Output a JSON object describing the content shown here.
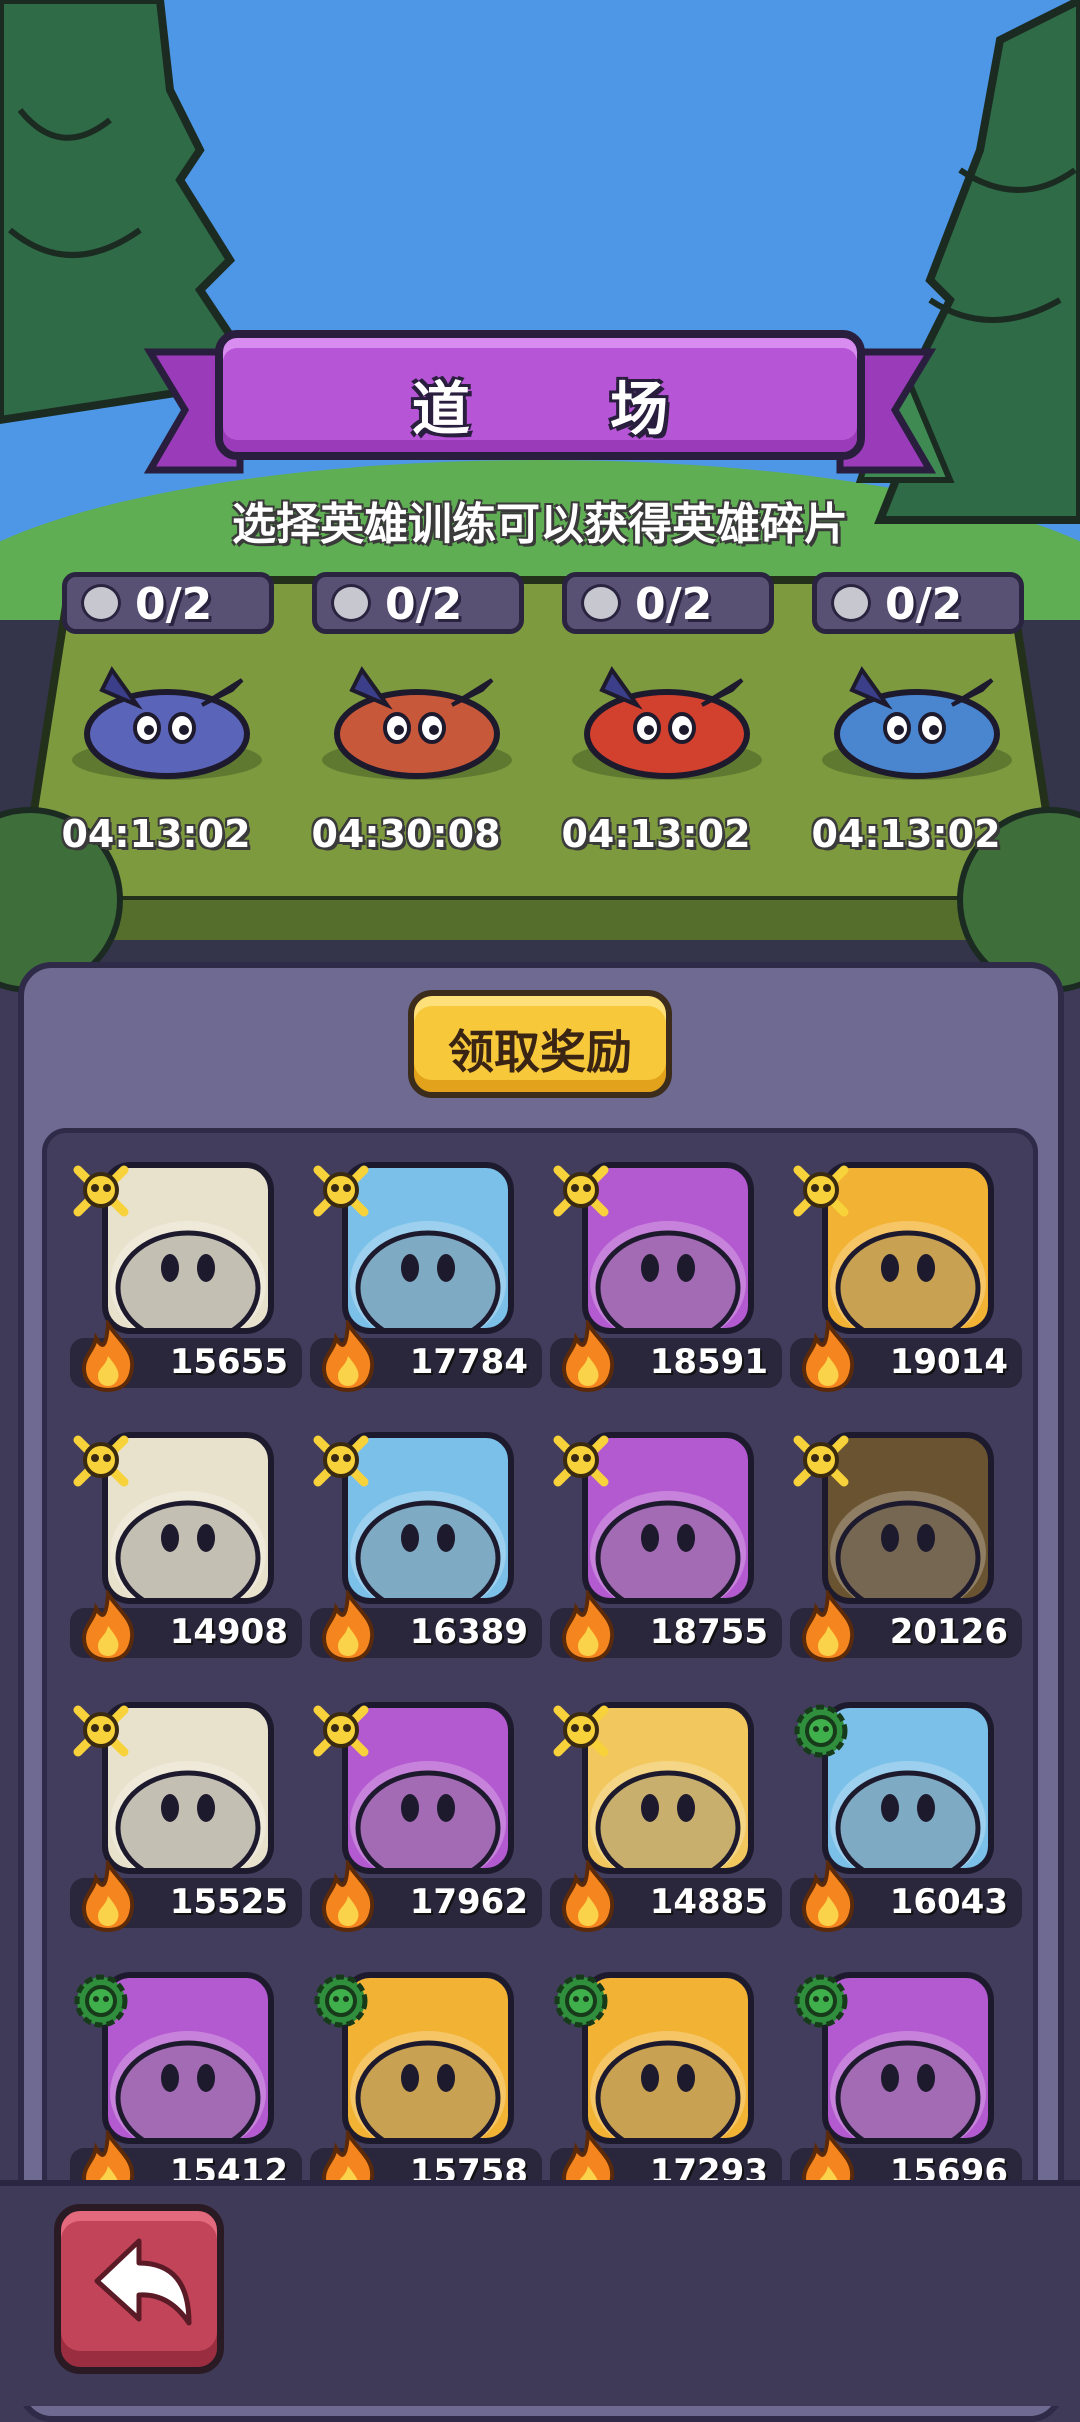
{
  "header": {
    "title": "道 场",
    "subtitle": "选择英雄训练可以获得英雄碎片"
  },
  "training_slots": [
    {
      "count": "0/2",
      "timer": "04:13:02",
      "hero_icon": "purple-horned-hero"
    },
    {
      "count": "0/2",
      "timer": "04:30:08",
      "hero_icon": "red-tentacle-shell-hero"
    },
    {
      "count": "0/2",
      "timer": "04:13:02",
      "hero_icon": "orange-bomb-hero"
    },
    {
      "count": "0/2",
      "timer": "04:13:02",
      "hero_icon": "blue-archer-hero"
    }
  ],
  "reward_button": {
    "label": "领取奖励"
  },
  "heroes": [
    {
      "power": "15655",
      "badge": "skull",
      "icon": "grey-helmet-hero",
      "bg": "#e8e2cc"
    },
    {
      "power": "17784",
      "badge": "skull",
      "icon": "red-horned-hero",
      "bg": "#7bc0e8"
    },
    {
      "power": "18591",
      "badge": "skull",
      "icon": "knight-helmet-hero",
      "bg": "#b45ad0"
    },
    {
      "power": "19014",
      "badge": "skull",
      "icon": "gold-crest-hero",
      "bg": "#f2b233"
    },
    {
      "power": "14908",
      "badge": "skull",
      "icon": "green-slime-hero",
      "bg": "#e8e2cc"
    },
    {
      "power": "16389",
      "badge": "skull",
      "icon": "cat-mask-hero",
      "bg": "#7bc0e8"
    },
    {
      "power": "18755",
      "badge": "skull",
      "icon": "green-hat-hero",
      "bg": "#b45ad0"
    },
    {
      "power": "20126",
      "badge": "skull",
      "icon": "brown-check-hero",
      "bg": "#6a5330"
    },
    {
      "power": "15525",
      "badge": "skull",
      "icon": "pink-bow-hero",
      "bg": "#e8e2cc"
    },
    {
      "power": "17962",
      "badge": "skull",
      "icon": "skull-hat-hero",
      "bg": "#b45ad0"
    },
    {
      "power": "14885",
      "badge": "skull",
      "icon": "pink-crown-hero",
      "bg": "#f2c85e"
    },
    {
      "power": "16043",
      "badge": "gear",
      "icon": "robot-block-hero",
      "bg": "#7bc0e8"
    },
    {
      "power": "15412",
      "badge": "gear",
      "icon": "grey-cat-robot-hero",
      "bg": "#b45ad0"
    },
    {
      "power": "15758",
      "badge": "gear",
      "icon": "silver-wolf-hero",
      "bg": "#f2b233"
    },
    {
      "power": "17293",
      "badge": "gear",
      "icon": "red-mech-hero",
      "bg": "#f2b233"
    },
    {
      "power": "15696",
      "badge": "gear",
      "icon": "cyber-knight-hero",
      "bg": "#b45ad0"
    }
  ],
  "back_button": {
    "icon": "back-arrow-icon"
  }
}
